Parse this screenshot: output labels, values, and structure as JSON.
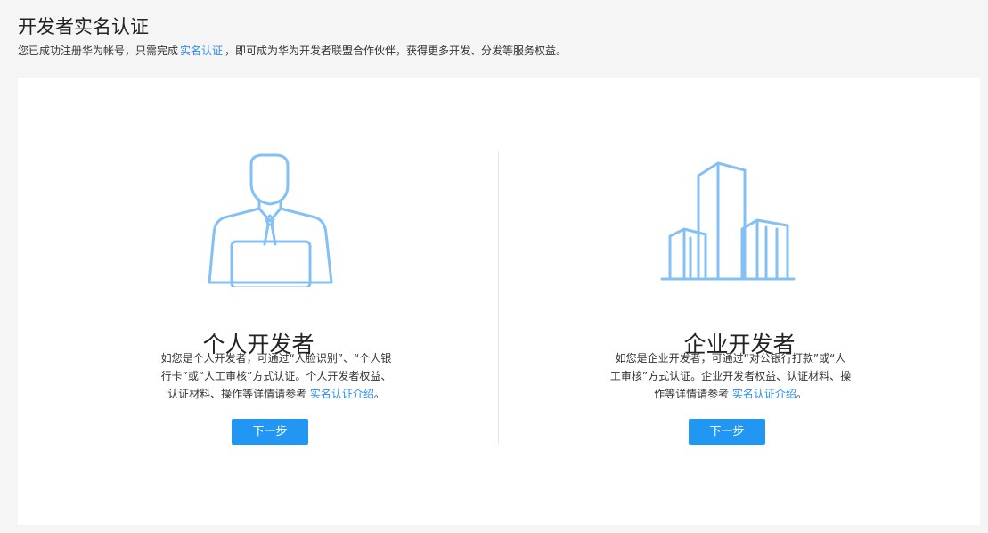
{
  "header": {
    "title": "开发者实名认证",
    "subtitle_prefix": "您已成功注册华为帐号，只需完成",
    "subtitle_link": "实名认证",
    "subtitle_suffix": "，即可成为华为开发者联盟合作伙伴，获得更多开发、分发等服务权益。"
  },
  "options": [
    {
      "title": "个人开发者",
      "desc_line1": "如您是个人开发者，可通过“人脸识别”、“个人银",
      "desc_line2": "行卡”或“人工审核”方式认证。个人开发者权益、",
      "desc_line3_prefix": "认证材料、操作等详情请参考",
      "desc_link": "实名认证介绍",
      "desc_suffix": "。",
      "button_label": "下一步",
      "icon": "developer-person-icon"
    },
    {
      "title": "企业开发者",
      "desc_line1": "如您是企业开发者，可通过“对公银行打款”或“人",
      "desc_line2": "工审核”方式认证。企业开发者权益、认证材料、操",
      "desc_line3_prefix": "作等详情请参考",
      "desc_link": "实名认证介绍",
      "desc_suffix": "。",
      "button_label": "下一步",
      "icon": "enterprise-building-icon"
    }
  ],
  "colors": {
    "accent": "#2196f3",
    "link": "#2a8cf0",
    "illustration": "#85c0f5"
  }
}
